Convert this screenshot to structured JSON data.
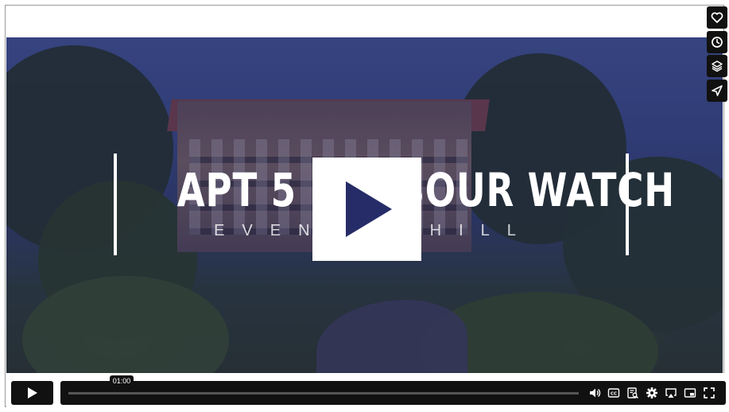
{
  "player": {
    "title": "APT 5 HARBOUR WATCH",
    "subtitle": "EVENING HILL",
    "time_tooltip": "01:00",
    "progress": 0.0
  },
  "side_buttons": [
    {
      "icon": "heart-icon"
    },
    {
      "icon": "clock-icon"
    },
    {
      "icon": "layers-icon"
    },
    {
      "icon": "share-icon"
    }
  ],
  "control_icons": [
    "volume-icon",
    "closed-captions-icon",
    "transcript-icon",
    "settings-icon",
    "airplay-icon",
    "picture-in-picture-icon",
    "fullscreen-icon"
  ],
  "colors": {
    "accent": "#262c67",
    "control_bg": "#111111",
    "overlay": "#2c3470"
  }
}
